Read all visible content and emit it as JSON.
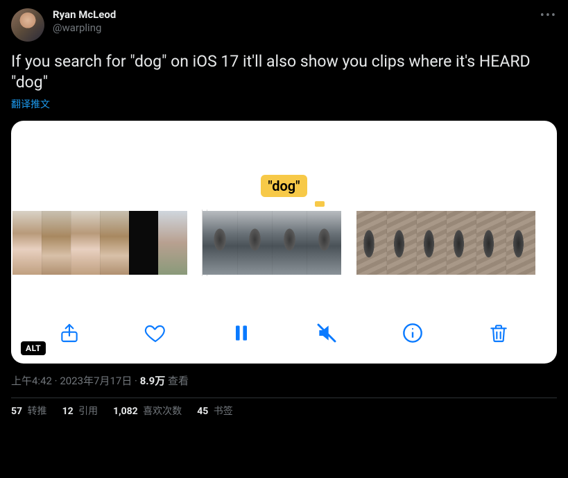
{
  "author": {
    "display_name": "Ryan McLeod",
    "handle": "@warpling"
  },
  "tweet_text": "If you search for \"dog\" on iOS 17 it'll also show you clips where it's HEARD \"dog\"",
  "translate_label": "翻译推文",
  "media": {
    "tooltip_text": "\"dog\"",
    "alt_badge": "ALT"
  },
  "meta": {
    "time": "上午4:42",
    "dot1": " · ",
    "date": "2023年7月17日",
    "dot2": " · ",
    "views_count": "8.9万",
    "views_label": " 查看"
  },
  "stats": {
    "retweets_count": "57",
    "retweets_label": " 转推",
    "quotes_count": "12",
    "quotes_label": " 引用",
    "likes_count": "1,082",
    "likes_label": " 喜欢次数",
    "bookmarks_count": "45",
    "bookmarks_label": " 书签"
  }
}
